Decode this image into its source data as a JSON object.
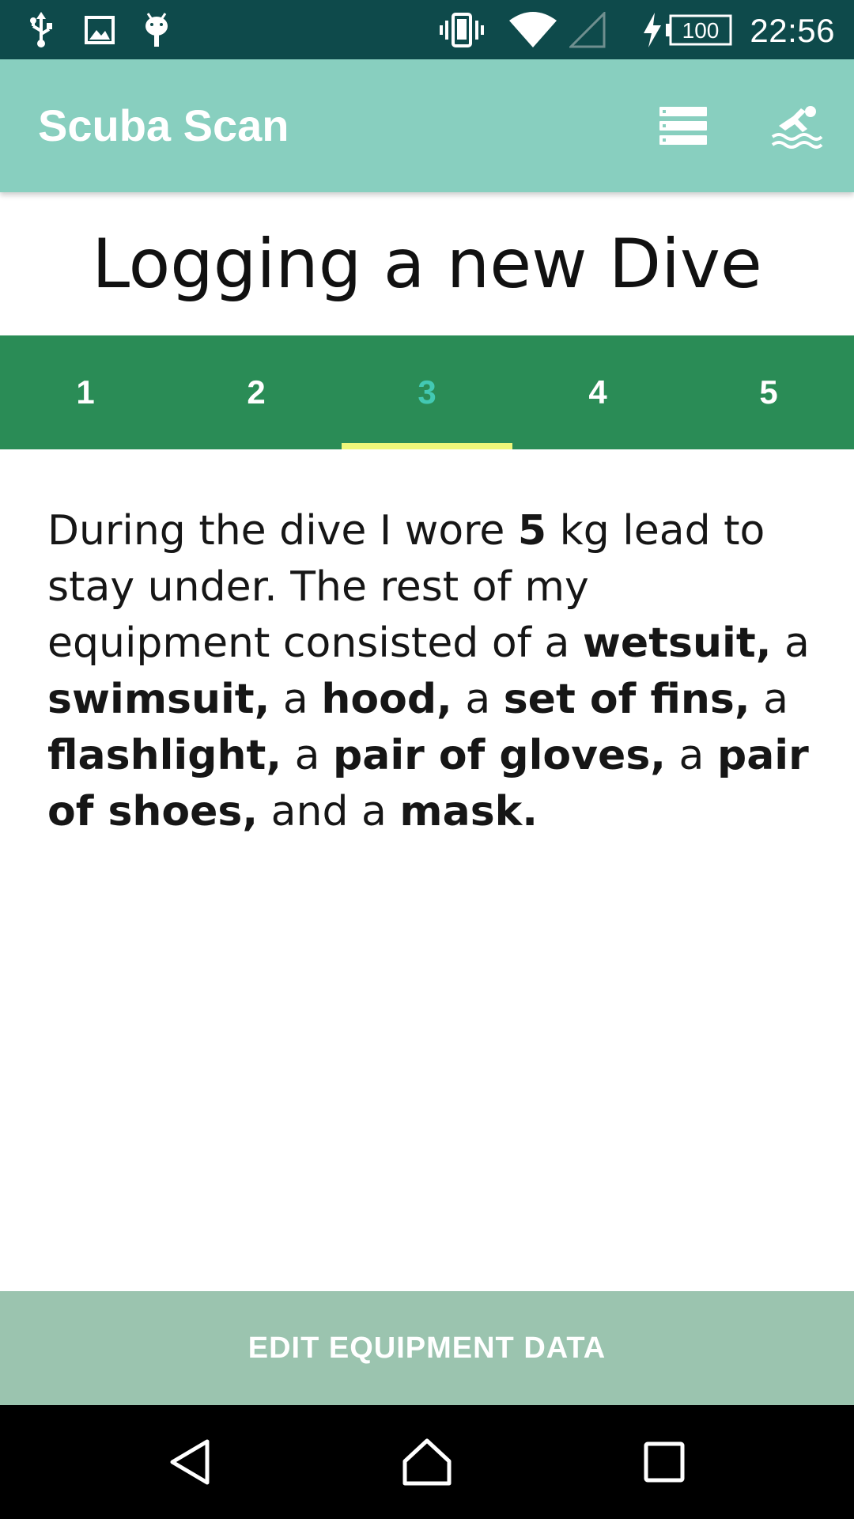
{
  "status_bar": {
    "left_icons": [
      "usb-icon",
      "image-icon",
      "android-debug-icon"
    ],
    "right_icons": [
      "vibrate-icon",
      "wifi-icon",
      "cell-signal-icon",
      "charging-icon"
    ],
    "battery_level": "100",
    "time": "22:56"
  },
  "app_bar": {
    "title": "Scuba Scan",
    "actions": [
      "list-icon",
      "swimmer-icon"
    ]
  },
  "page": {
    "heading": "Logging a new Dive"
  },
  "tabs": {
    "items": [
      "1",
      "2",
      "3",
      "4",
      "5"
    ],
    "active_index": 2
  },
  "summary": {
    "t1": "During the dive I wore ",
    "weight": "5",
    "t2": " kg lead to stay under. The rest of my equipment consisted of a ",
    "item1": "wetsuit,",
    "t3": " a ",
    "item2": "swimsuit,",
    "t4": " a ",
    "item3": "hood,",
    "t5": " a ",
    "item4": "set of fins,",
    "t6": " a ",
    "item5": "flashlight,",
    "t7": " a ",
    "item6": "pair of gloves,",
    "t8": " a ",
    "item7": "pair of shoes,",
    "t9": " and a ",
    "item8": "mask."
  },
  "bottom_button": {
    "label": "EDIT EQUIPMENT DATA"
  },
  "nav_bar": {
    "buttons": [
      "back-icon",
      "home-icon",
      "recents-icon"
    ]
  },
  "colors": {
    "status_bar": "#0e4a4b",
    "app_bar": "#88cfbf",
    "tabs": "#2a8c56",
    "active_tab_text": "#43c9b3",
    "tab_indicator": "#eef77a",
    "bottom_button": "#9bc4af",
    "nav_bar": "#000000"
  }
}
